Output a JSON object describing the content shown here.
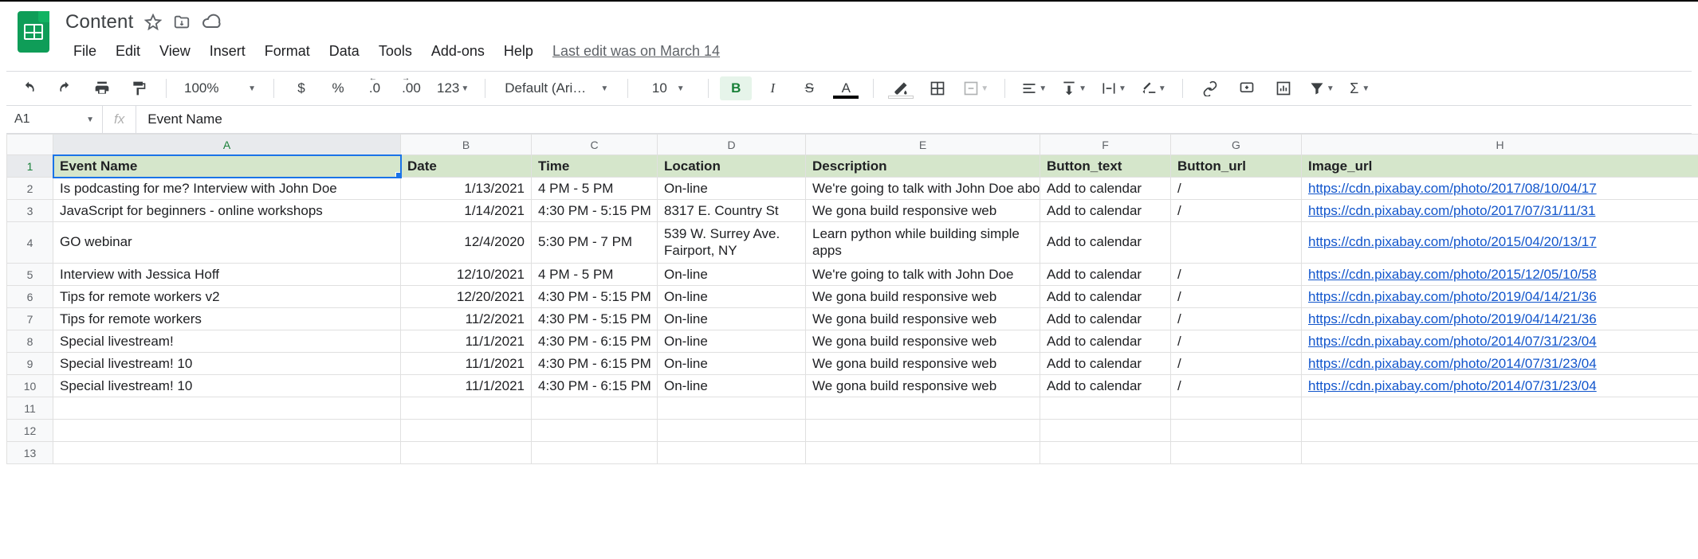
{
  "doc": {
    "title": "Content"
  },
  "menu": {
    "file": "File",
    "edit": "Edit",
    "view": "View",
    "insert": "Insert",
    "format": "Format",
    "data": "Data",
    "tools": "Tools",
    "addons": "Add-ons",
    "help": "Help",
    "last_edit": "Last edit was on March 14"
  },
  "toolbar": {
    "zoom": "100%",
    "font": "Default (Ari…",
    "font_size": "10",
    "currency": "$",
    "percent": "%",
    "dec_dec": ".0",
    "inc_dec": ".00",
    "more_fmt": "123",
    "bold": "B",
    "italic": "I",
    "strike": "S",
    "text_color": "A",
    "sigma": "Σ"
  },
  "namebox": {
    "ref": "A1",
    "formula": "Event Name"
  },
  "columns": [
    "A",
    "B",
    "C",
    "D",
    "E",
    "F",
    "G",
    "H"
  ],
  "headers": {
    "A": "Event Name",
    "B": "Date",
    "C": "Time",
    "D": "Location",
    "E": "Description",
    "F": "Button_text",
    "G": "Button_url",
    "H": "Image_url"
  },
  "rows": [
    {
      "n": 2,
      "A": "Is podcasting for me? Interview with John Doe",
      "B": "1/13/2021",
      "C": "4 PM - 5 PM",
      "D": "On-line",
      "E": "We're going to talk with John Doe about podcasting",
      "F": "Add to calendar",
      "G": "/",
      "H": "https://cdn.pixabay.com/photo/2017/08/10/04/17"
    },
    {
      "n": 3,
      "A": "JavaScript for beginners - online workshops",
      "B": "1/14/2021",
      "C": "4:30 PM - 5:15 PM",
      "D": "8317 E. Country St",
      "E": "We gona build responsive web",
      "F": "Add to calendar",
      "G": "/",
      "H": "https://cdn.pixabay.com/photo/2017/07/31/11/31"
    },
    {
      "n": 4,
      "wrap": true,
      "A": "GO webinar",
      "B": "12/4/2020",
      "C": "5:30 PM - 7 PM",
      "D": "539 W. Surrey Ave. Fairport, NY",
      "E": "Learn python while building simple apps",
      "F": "Add to calendar",
      "G": "",
      "H": "https://cdn.pixabay.com/photo/2015/04/20/13/17"
    },
    {
      "n": 5,
      "A": "Interview with Jessica Hoff",
      "B": "12/10/2021",
      "C": "4 PM - 5 PM",
      "D": "On-line",
      "E": "We're going to talk with John Doe",
      "F": "Add to calendar",
      "G": "/",
      "H": "https://cdn.pixabay.com/photo/2015/12/05/10/58"
    },
    {
      "n": 6,
      "A": "Tips for remote workers v2",
      "B": "12/20/2021",
      "C": "4:30 PM - 5:15 PM",
      "D": "On-line",
      "E": "We gona build responsive web",
      "F": "Add to calendar",
      "G": "/",
      "H": "https://cdn.pixabay.com/photo/2019/04/14/21/36"
    },
    {
      "n": 7,
      "A": "Tips for remote workers",
      "B": "11/2/2021",
      "C": "4:30 PM - 5:15 PM",
      "D": "On-line",
      "E": "We gona build responsive web",
      "F": "Add to calendar",
      "G": "/",
      "H": "https://cdn.pixabay.com/photo/2019/04/14/21/36"
    },
    {
      "n": 8,
      "A": "Special livestream!",
      "B": "11/1/2021",
      "C": "4:30 PM - 6:15 PM",
      "D": "On-line",
      "E": "We gona build responsive web",
      "F": "Add to calendar",
      "G": "/",
      "H": "https://cdn.pixabay.com/photo/2014/07/31/23/04"
    },
    {
      "n": 9,
      "A": "Special livestream! 10",
      "B": "11/1/2021",
      "C": "4:30 PM - 6:15 PM",
      "D": "On-line",
      "E": "We gona build responsive web",
      "F": "Add to calendar",
      "G": "/",
      "H": "https://cdn.pixabay.com/photo/2014/07/31/23/04"
    },
    {
      "n": 10,
      "A": "Special livestream! 10",
      "B": "11/1/2021",
      "C": "4:30 PM - 6:15 PM",
      "D": "On-line",
      "E": "We gona build responsive web",
      "F": "Add to calendar",
      "G": "/",
      "H": "https://cdn.pixabay.com/photo/2014/07/31/23/04"
    }
  ],
  "empty_rows": [
    11,
    12,
    13
  ]
}
